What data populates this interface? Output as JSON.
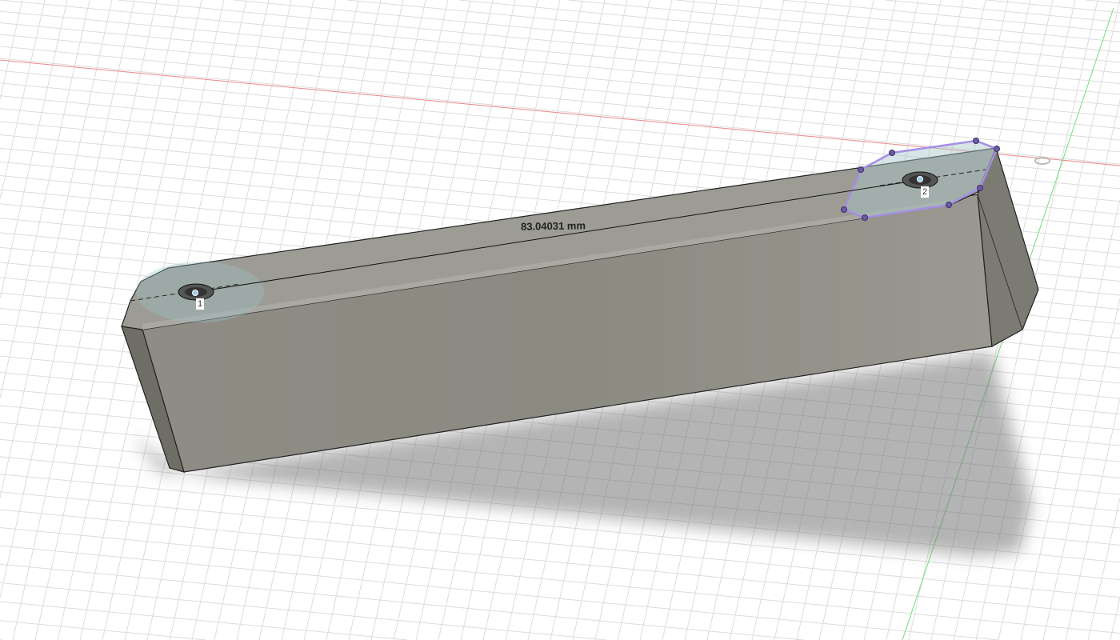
{
  "viewport": {
    "dimension_value": "83.04031 mm",
    "point_labels": [
      "1",
      "2"
    ],
    "colors": {
      "x_axis": "#e86a6a",
      "y_axis": "#5ccf5c",
      "selection": "#a58ee6",
      "body": "#8a8a80"
    }
  }
}
